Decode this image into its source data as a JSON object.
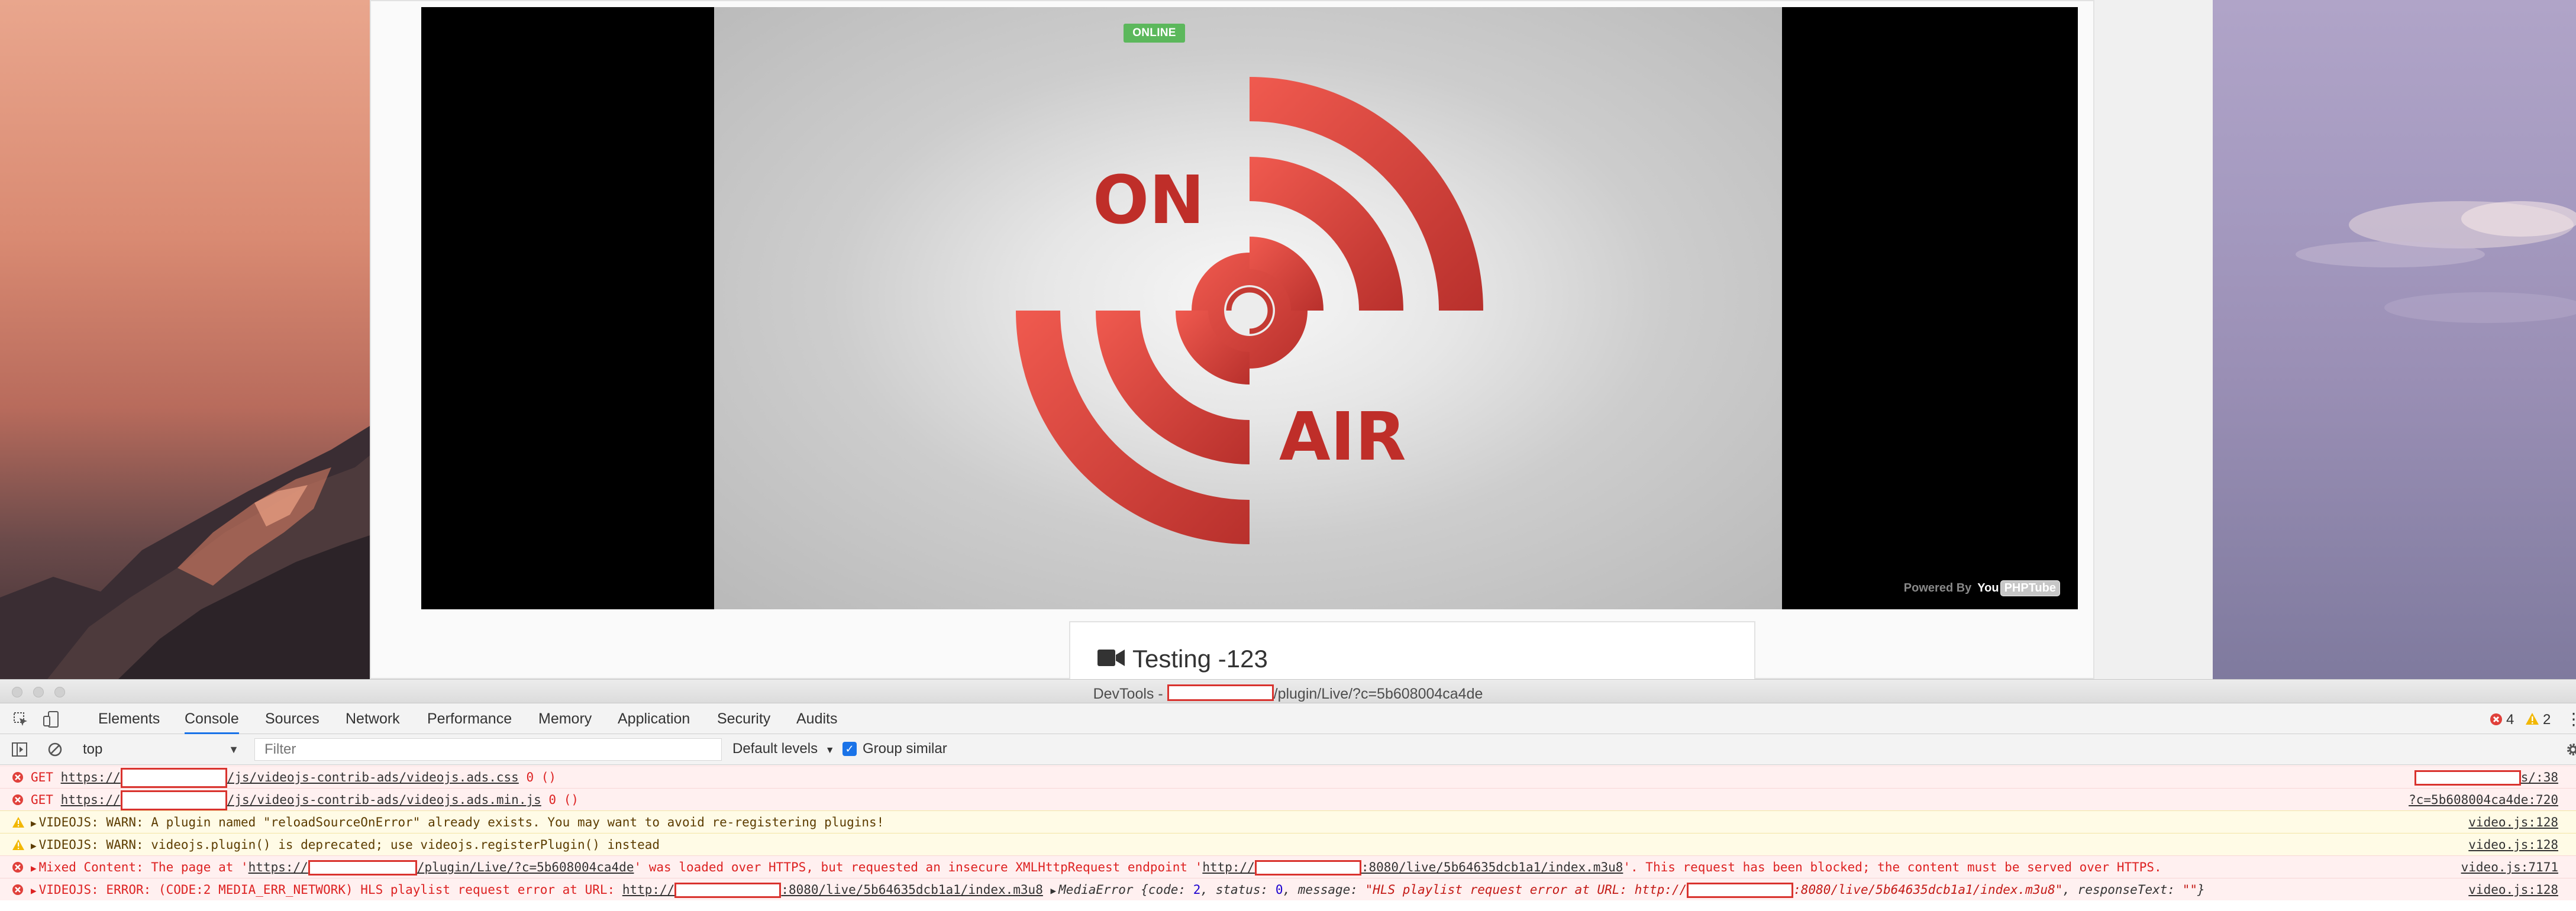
{
  "player": {
    "badge": "ONLINE",
    "powered_by": "Powered By",
    "brand_you": "You",
    "brand_tube": "PHPTube",
    "on_air_word1": "ON",
    "on_air_word2": "AIR"
  },
  "video_card": {
    "title": "Testing -123",
    "icon": "video-camera-icon"
  },
  "devtools": {
    "title_prefix": "DevTools - ",
    "title_suffix": "/plugin/Live/?c=5b608004ca4de",
    "tabs": [
      "Elements",
      "Console",
      "Sources",
      "Network",
      "Performance",
      "Memory",
      "Application",
      "Security",
      "Audits"
    ],
    "active_tab": "Console",
    "error_count": "4",
    "warning_count": "2",
    "context": "top",
    "filter_placeholder": "Filter",
    "levels_label": "Default levels",
    "group_similar_label": "Group similar",
    "group_similar_checked": true
  },
  "console": {
    "rows": [
      {
        "type": "error",
        "method": "GET",
        "url_prefix": "https://",
        "url_suffix": "/js/videojs-contrib-ads/videojs.ads.css",
        "status": "0 ()",
        "source": "s/:38"
      },
      {
        "type": "error",
        "method": "GET",
        "url_prefix": "https://",
        "url_suffix": "/js/videojs-contrib-ads/videojs.ads.min.js",
        "status": "0 ()",
        "source": "?c=5b608004ca4de:720"
      },
      {
        "type": "warning",
        "text": "VIDEOJS: WARN: A plugin named \"reloadSourceOnError\" already exists. You may want to avoid re-registering plugins!",
        "source": "video.js:128"
      },
      {
        "type": "warning",
        "text": "VIDEOJS: WARN: videojs.plugin() is deprecated; use videojs.registerPlugin() instead",
        "source": "video.js:128"
      },
      {
        "type": "error",
        "part1": "Mixed Content: The page at '",
        "link1_prefix": "https://",
        "link1_suffix": "/plugin/Live/?c=5b608004ca4de",
        "part2": "' was loaded over HTTPS, but requested an insecure XMLHttpRequest endpoint '",
        "link2_prefix": "http://",
        "link2_suffix": ":8080/live/5b64635dcb1a1/index.m3u8",
        "part3": "'. This request has been blocked; the content must be served over HTTPS.",
        "source": "video.js:7171"
      },
      {
        "type": "error",
        "part1": "VIDEOJS: ERROR: (CODE:2 MEDIA_ERR_NETWORK) HLS playlist request error at URL: ",
        "link1_prefix": "http://",
        "link1_suffix": ":8080/live/5b64635dcb1a1/index.m3u8",
        "obj_name": "MediaError",
        "obj_body_1": "{code: ",
        "obj_code": "2",
        "obj_body_2": ", status: ",
        "obj_status": "0",
        "obj_body_3": ", message: ",
        "obj_msg_prefix": "\"HLS playlist request error at URL: http://",
        "obj_msg_suffix": ":8080/live/5b64635dcb1a1/index.m3u8\"",
        "obj_body_4": ", responseText: ",
        "obj_resp": "\"\"",
        "obj_close": "}",
        "source": "video.js:128"
      }
    ]
  },
  "colors": {
    "error_text": "#d22222",
    "error_bg": "#fff0f0",
    "warn_bg": "#fffbe6",
    "redaction": "#d9332e",
    "online": "#5cb85c",
    "on_air_red": "#e2443d"
  }
}
